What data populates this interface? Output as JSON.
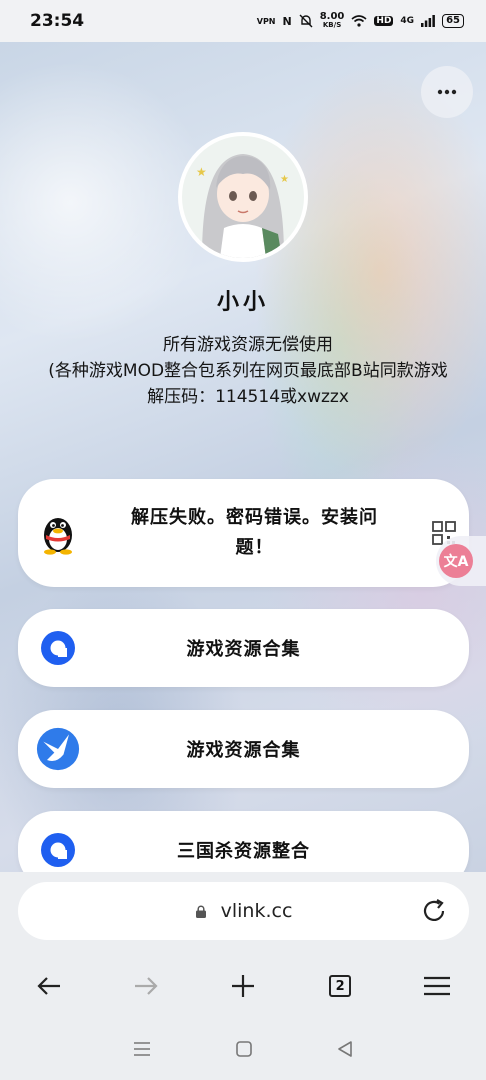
{
  "status_bar": {
    "time": "23:54",
    "vpn": "VPN",
    "nfc": "N",
    "speed_value": "8.00",
    "speed_unit": "KB/S",
    "hd": "HD",
    "network": "4G",
    "battery": "65"
  },
  "profile": {
    "name": "小小",
    "bio_lines": [
      "所有游戏资源无偿使用",
      "(各种游戏MOD整合包系列在网页最底部B站同款游戏",
      "解压码：114514或xwzzx"
    ]
  },
  "links": [
    {
      "label": "解压失败。密码错误。安装问题！",
      "icon": "qq-penguin-icon"
    },
    {
      "label": "游戏资源合集",
      "icon": "cloud-drive-icon"
    },
    {
      "label": "游戏资源合集",
      "icon": "bird-icon"
    },
    {
      "label": "三国杀资源整合",
      "icon": "cloud-drive-icon"
    }
  ],
  "browser": {
    "url": "vlink.cc",
    "tab_count": "2"
  },
  "colors": {
    "accent_blue": "#1f5ff0",
    "card_bg": "#ffffff",
    "chrome_bg": "#eceef1",
    "badge_pink": "#ec7f96"
  }
}
